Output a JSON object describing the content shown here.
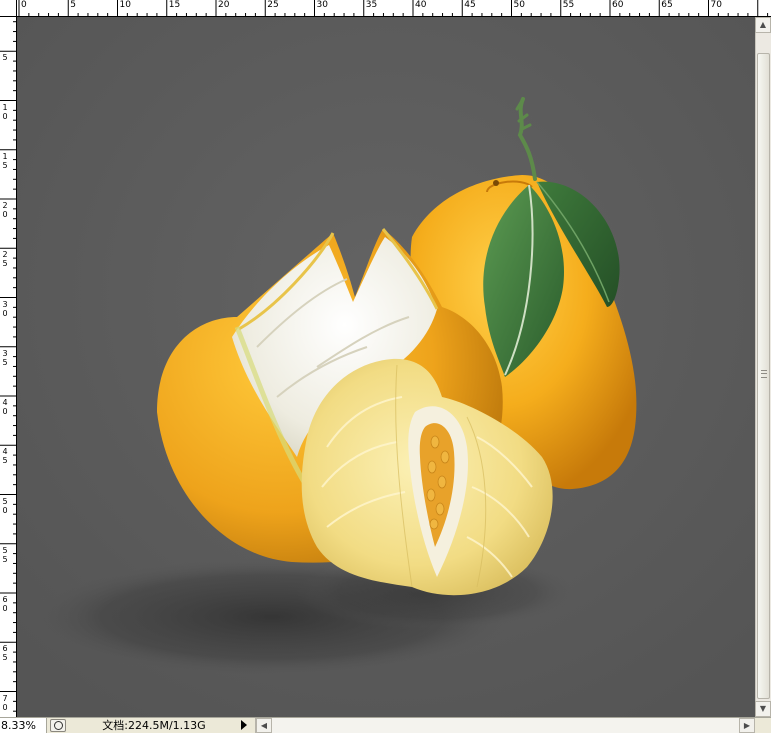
{
  "rulers": {
    "top_labels": [
      "0",
      "5",
      "10",
      "15",
      "20",
      "25",
      "30",
      "35",
      "40",
      "45",
      "50",
      "55",
      "60",
      "65",
      "70"
    ],
    "left_labels": [
      "5",
      "10",
      "15",
      "20",
      "25",
      "30",
      "35",
      "40",
      "45",
      "50",
      "55",
      "60",
      "65",
      "70"
    ]
  },
  "canvas": {
    "background": "#5a5a5a",
    "artwork": "pomelo-illustration"
  },
  "status": {
    "zoom": "8.33%",
    "doc_info": "文档:224.5M/1.13G"
  },
  "colors": {
    "rind": "#f0a81c",
    "pith": "#f3f1e6",
    "pulp": "#f2df8a",
    "leaf": "#3d7a3c"
  }
}
